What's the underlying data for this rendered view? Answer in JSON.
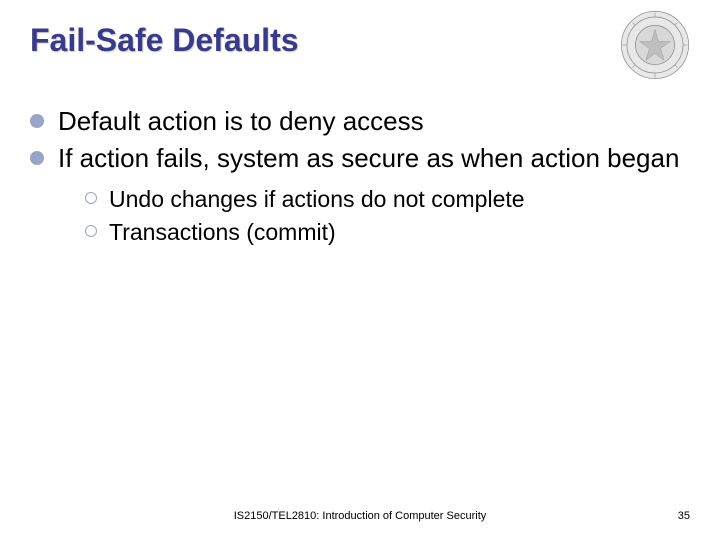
{
  "title": "Fail-Safe Defaults",
  "bullets_l1": [
    "Default action is to deny access",
    "If action fails, system as secure as when action began"
  ],
  "bullets_l2": [
    "Undo changes if actions do not complete",
    "Transactions (commit)"
  ],
  "footer": "IS2150/TEL2810: Introduction of Computer Security",
  "page_number": "35",
  "seal_icon": "university-seal-icon"
}
